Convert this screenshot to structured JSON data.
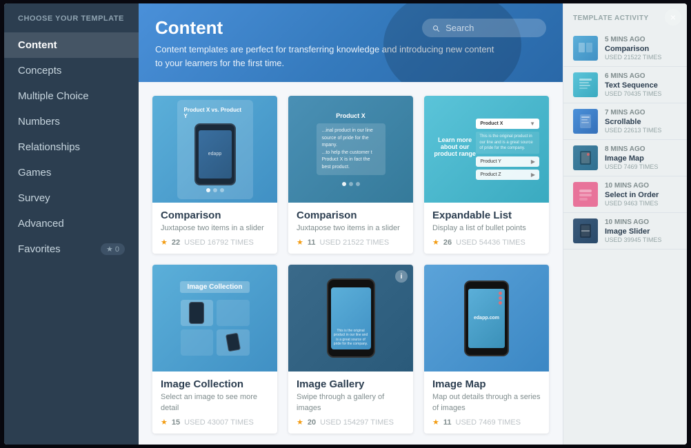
{
  "modal": {
    "close_label": "×"
  },
  "sidebar": {
    "header": "CHOOSE YOUR TEMPLATE",
    "items": [
      {
        "id": "content",
        "label": "Content",
        "active": true
      },
      {
        "id": "concepts",
        "label": "Concepts",
        "active": false
      },
      {
        "id": "multiple-choice",
        "label": "Multiple Choice",
        "active": false
      },
      {
        "id": "numbers",
        "label": "Numbers",
        "active": false
      },
      {
        "id": "relationships",
        "label": "Relationships",
        "active": false
      },
      {
        "id": "games",
        "label": "Games",
        "active": false
      },
      {
        "id": "survey",
        "label": "Survey",
        "active": false
      },
      {
        "id": "advanced",
        "label": "Advanced",
        "active": false
      },
      {
        "id": "favorites",
        "label": "Favorites",
        "active": false
      }
    ],
    "favorites_count": "0"
  },
  "main": {
    "title": "Content",
    "description": "Content templates are perfect for transferring knowledge and introducing new content to your learners for the first time.",
    "search_placeholder": "Search"
  },
  "templates": [
    {
      "id": "comparison1",
      "name": "Comparison",
      "description": "Juxtapose two items in a slider",
      "rating": 22,
      "uses": "USED 16792 TIMES",
      "preview_type": "comparison1"
    },
    {
      "id": "comparison2",
      "name": "Comparison",
      "description": "Juxtapose two items in a slider",
      "rating": 11,
      "uses": "USED 21522 TIMES",
      "preview_type": "comparison2"
    },
    {
      "id": "expandable-list",
      "name": "Expandable List",
      "description": "Display a list of bullet points",
      "rating": 26,
      "uses": "USED 54436 TIMES",
      "preview_type": "expandable"
    },
    {
      "id": "image-collection",
      "name": "Image Collection",
      "description": "Select an image to see more detail",
      "rating": 15,
      "uses": "USED 43007 TIMES",
      "preview_type": "imgcol"
    },
    {
      "id": "image-gallery",
      "name": "Image Gallery",
      "description": "Swipe through a gallery of images",
      "rating": 20,
      "uses": "USED 154297 TIMES",
      "preview_type": "imggal"
    },
    {
      "id": "image-map",
      "name": "Image Map",
      "description": "Map out details through a series of images",
      "rating": 11,
      "uses": "USED 7469 TIMES",
      "preview_type": "imgmap"
    }
  ],
  "activity": {
    "header": "TEMPLATE ACTIVITY",
    "items": [
      {
        "time": "5 MINS AGO",
        "name": "Comparison",
        "uses": "USED 21522 TIMES",
        "thumb": "blue"
      },
      {
        "time": "6 MINS AGO",
        "name": "Text Sequence",
        "uses": "USED 70435 TIMES",
        "thumb": "teal"
      },
      {
        "time": "7 MINS AGO",
        "name": "Scrollable",
        "uses": "USED 22613 TIMES",
        "thumb": "scroll"
      },
      {
        "time": "8 MINS AGO",
        "name": "Image Map",
        "uses": "USED 7469 TIMES",
        "thumb": "imgmap"
      },
      {
        "time": "10 MINS AGO",
        "name": "Select in Order",
        "uses": "USED 9463 TIMES",
        "thumb": "pink"
      },
      {
        "time": "10 MINS AGO",
        "name": "Image Slider",
        "uses": "USED 39945 TIMES",
        "thumb": "dark"
      }
    ]
  }
}
